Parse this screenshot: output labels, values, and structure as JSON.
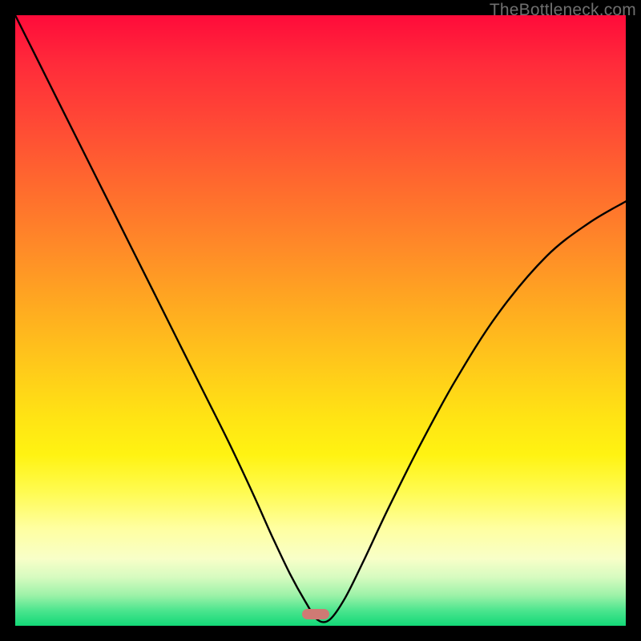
{
  "watermark": "TheBottleneck.com",
  "marker": {
    "x_frac": 0.492,
    "y_frac": 0.981
  },
  "chart_data": {
    "type": "line",
    "title": "",
    "xlabel": "",
    "ylabel": "",
    "xlim": [
      0,
      1
    ],
    "ylim": [
      0,
      1
    ],
    "background_gradient": {
      "top_color": "#ff0b3a",
      "bottom_color": "#12d877",
      "meaning": "bottleneck severity (red=high, green=low)"
    },
    "series": [
      {
        "name": "bottleneck-curve",
        "x": [
          0.0,
          0.03,
          0.07,
          0.11,
          0.15,
          0.19,
          0.23,
          0.27,
          0.31,
          0.35,
          0.39,
          0.42,
          0.45,
          0.475,
          0.495,
          0.515,
          0.54,
          0.57,
          0.61,
          0.66,
          0.72,
          0.79,
          0.87,
          0.94,
          1.0
        ],
        "y": [
          1.0,
          0.94,
          0.86,
          0.78,
          0.7,
          0.62,
          0.54,
          0.46,
          0.38,
          0.3,
          0.215,
          0.148,
          0.085,
          0.04,
          0.01,
          0.01,
          0.045,
          0.105,
          0.19,
          0.29,
          0.4,
          0.51,
          0.605,
          0.66,
          0.695
        ],
        "note": "y is fraction of plot height from bottom (0=bottom,1=top); curve dips to ~0 near x≈0.50"
      }
    ],
    "minimum_marker": {
      "x": 0.492,
      "y": 0.019
    }
  }
}
